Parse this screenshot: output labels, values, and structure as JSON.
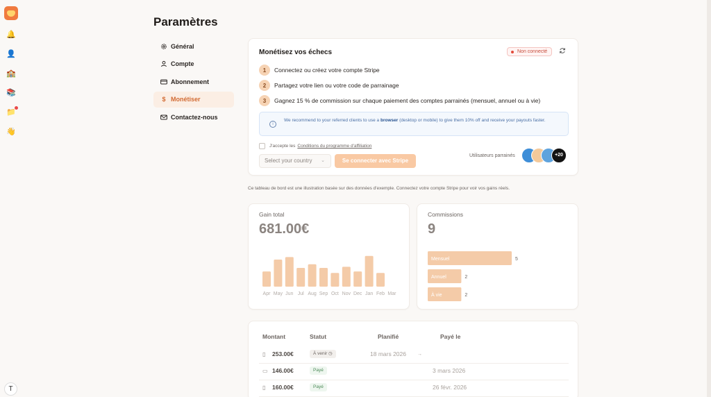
{
  "rail": {
    "icons": [
      "app-logo",
      "bell-icon",
      "user-icon",
      "school-icon",
      "books-icon",
      "folder-icon",
      "hand-icon"
    ],
    "user_initial": "T"
  },
  "page": {
    "title": "Paramètres"
  },
  "nav": [
    {
      "label": "Général",
      "icon": "gear-icon",
      "active": false
    },
    {
      "label": "Compte",
      "icon": "user-icon",
      "active": false
    },
    {
      "label": "Abonnement",
      "icon": "card-icon",
      "active": false
    },
    {
      "label": "Monétiser",
      "icon": "dollar-icon",
      "active": true
    },
    {
      "label": "Contactez-nous",
      "icon": "mail-icon",
      "active": false
    }
  ],
  "monetize": {
    "title": "Monétisez vos échecs",
    "status_badge": "Non connecté",
    "steps": [
      {
        "num": "1",
        "text": "Connectez ou créez votre compte Stripe"
      },
      {
        "num": "2",
        "text": "Partagez votre lien ou votre code de parrainage"
      },
      {
        "num": "3",
        "text": "Gagnez 15 % de commission sur chaque paiement des comptes parrainés (mensuel, annuel ou à vie)"
      }
    ],
    "info_before": "We recommend to your referred clients to use a ",
    "info_bold": "browser",
    "info_after": " (desktop or mobile) to give them 10% off and receive your payouts faster.",
    "terms_prefix": "J'accepte les",
    "terms_link": "Conditions du programme d'affiliation",
    "country_placeholder": "Select your country",
    "connect_button": "Se connecter avec Stripe",
    "referred_label": "Utilisateurs parrainés",
    "referred_more": "+20"
  },
  "note": "Ce tableau de bord est une illustration basée sur des données d'exemple. Connectez votre compte Stripe pour voir vos gains réels.",
  "gain": {
    "label": "Gain total",
    "value": "681.00€"
  },
  "commissions": {
    "label": "Commissions",
    "value": "9"
  },
  "colors": {
    "accent": "#d26b33",
    "bar": "#f4cba8",
    "stripe_button": "#f9c9a3"
  },
  "chart_data": [
    {
      "type": "bar",
      "categories": [
        "Apr",
        "May",
        "Jun",
        "Jul",
        "Aug",
        "Sep",
        "Oct",
        "Nov",
        "Dec",
        "Jan",
        "Feb",
        "Mar"
      ],
      "values": [
        42,
        75,
        82,
        52,
        62,
        52,
        38,
        55,
        42,
        85,
        38,
        0
      ],
      "title": "",
      "xlabel": "",
      "ylabel": "",
      "ylim": [
        0,
        100
      ]
    },
    {
      "type": "bar",
      "orientation": "horizontal",
      "categories": [
        "Mensuel",
        "Annuel",
        "À vie"
      ],
      "values": [
        5,
        2,
        2
      ],
      "title": "",
      "xlabel": "",
      "ylabel": ""
    }
  ],
  "table": {
    "headers": [
      "Montant",
      "Statut",
      "Planifié",
      "Payé le"
    ],
    "rows": [
      {
        "icon": "phone-icon",
        "amount": "253.00€",
        "status": "À venir",
        "status_type": "upcoming",
        "planned": "18 mars 2026",
        "arrow": "→",
        "paid_on": ""
      },
      {
        "icon": "desktop-icon",
        "amount": "146.00€",
        "status": "Payé",
        "status_type": "paid",
        "planned": "",
        "arrow": "",
        "paid_on": "3 mars 2026"
      },
      {
        "icon": "phone-icon",
        "amount": "160.00€",
        "status": "Payé",
        "status_type": "paid",
        "planned": "",
        "arrow": "",
        "paid_on": "26 févr. 2026"
      }
    ]
  }
}
